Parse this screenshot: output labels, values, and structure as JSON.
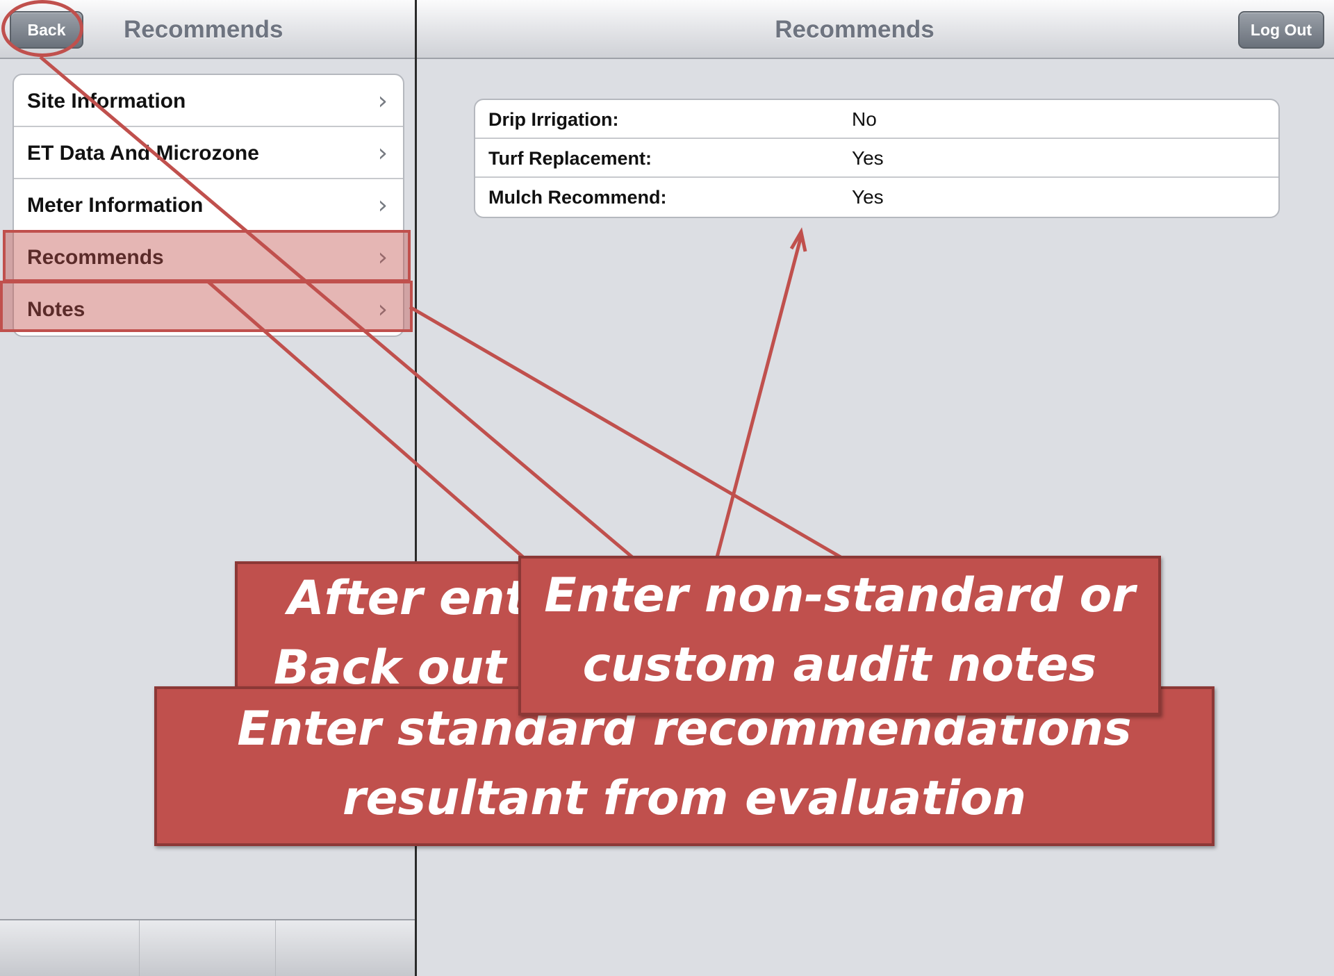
{
  "left_pane": {
    "navbar": {
      "back_label": "Back",
      "title": "Recommends"
    },
    "menu_items": [
      {
        "label": "Site Information",
        "icon": "chevron-right-icon"
      },
      {
        "label": "ET Data And Microzone",
        "icon": "chevron-right-icon"
      },
      {
        "label": "Meter Information",
        "icon": "chevron-right-icon"
      },
      {
        "label": "Recommends",
        "icon": "chevron-right-icon"
      },
      {
        "label": "Notes",
        "icon": "chevron-right-icon"
      }
    ],
    "chevron_glyph": "›"
  },
  "right_pane": {
    "navbar": {
      "title": "Recommends",
      "logout_label": "Log Out"
    },
    "rows": [
      {
        "label": "Drip Irrigation:",
        "value": "No"
      },
      {
        "label": "Turf Replacement:",
        "value": "Yes"
      },
      {
        "label": "Mulch Recommend:",
        "value": "Yes"
      }
    ]
  },
  "annotations": {
    "callout_back": {
      "line1": "After ente",
      "line2": "Back out t"
    },
    "callout_notes": {
      "line1": "Enter non-standard or",
      "line2": "custom audit notes"
    },
    "callout_recommend": {
      "line1": "Enter standard recommendations",
      "line2": "resultant from evaluation"
    },
    "accent_color": "#c0504d"
  }
}
